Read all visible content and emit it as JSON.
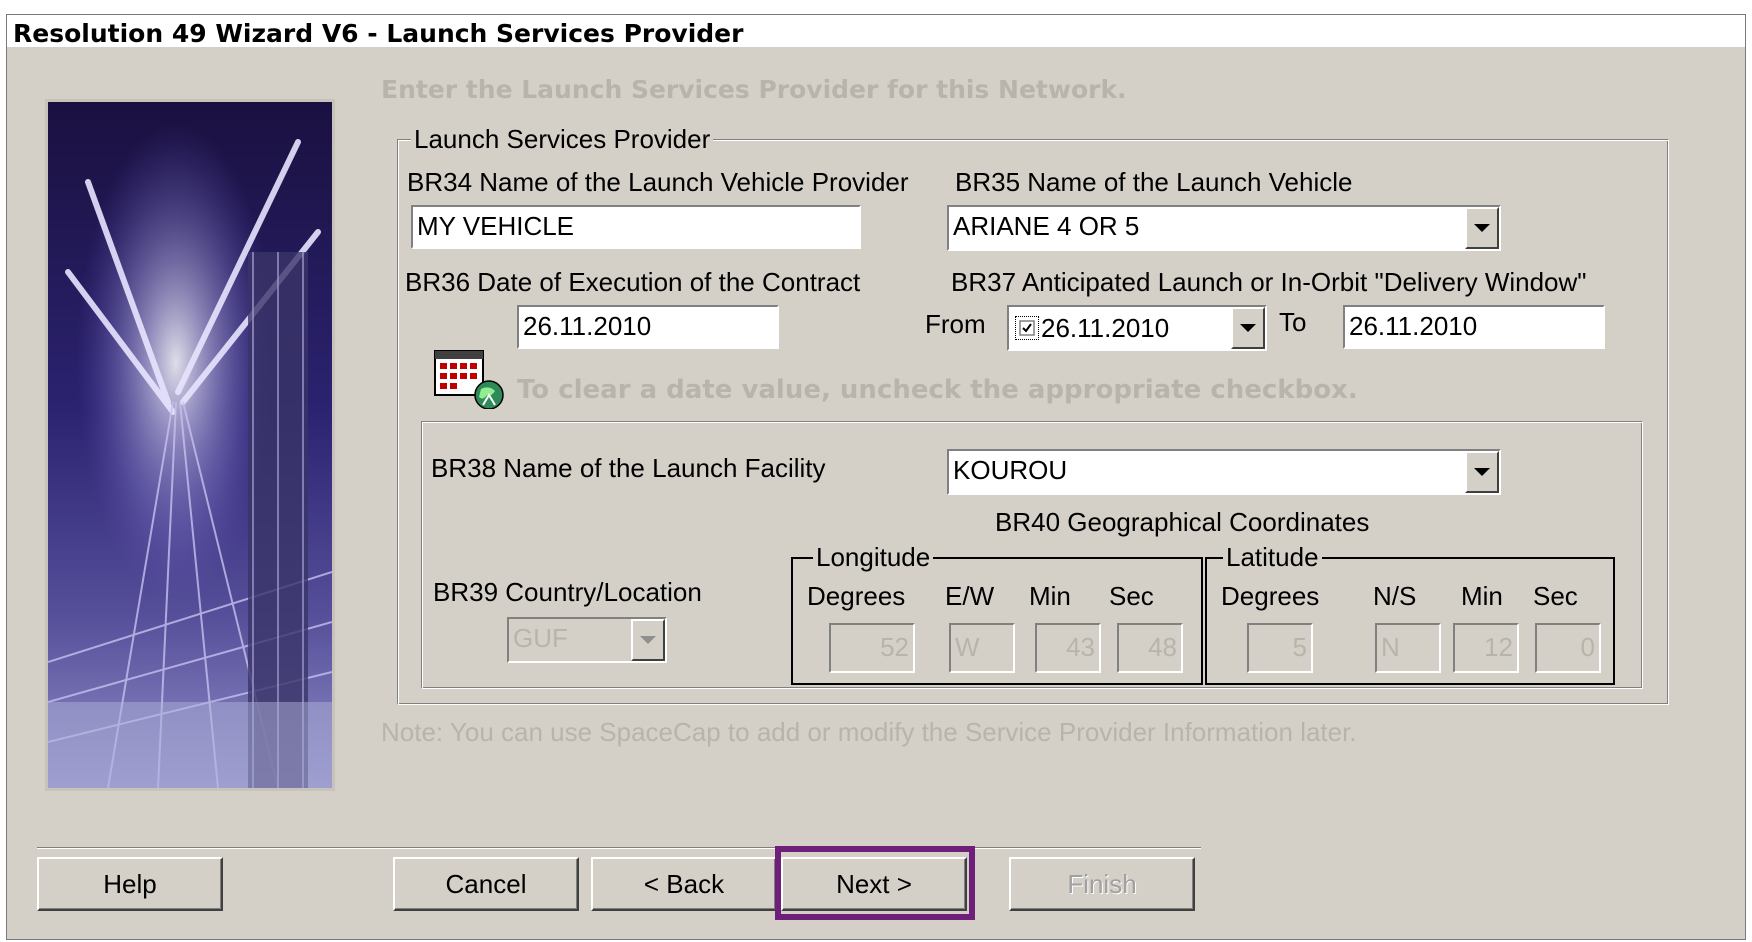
{
  "window": {
    "title": "Resolution 49 Wizard V6 - Launch Services Provider"
  },
  "instruction": "Enter the Launch Services Provider for this Network.",
  "group_launch": {
    "legend": "Launch Services Provider",
    "br34": {
      "label": "BR34  Name of the Launch Vehicle Provider",
      "value": "MY VEHICLE"
    },
    "br35": {
      "label": "BR35  Name of the Launch Vehicle",
      "value": "ARIANE 4 OR  5"
    },
    "br36": {
      "label": "BR36  Date of Execution of the Contract",
      "value": "26.11.2010"
    },
    "br37": {
      "label": "BR37  Anticipated Launch or In-Orbit \"Delivery Window\"",
      "from_label": "From",
      "from_value": "26.11.2010",
      "from_checked": true,
      "to_label": "To",
      "to_value": "26.11.2010"
    },
    "date_hint": "To clear a date value, uncheck the appropriate checkbox."
  },
  "facility": {
    "br38": {
      "label": "BR38  Name of the Launch Facility",
      "value": "KOUROU"
    },
    "br40_label": "BR40  Geographical Coordinates",
    "br39": {
      "label": "BR39 Country/Location",
      "value": "GUF"
    },
    "longitude": {
      "legend": "Longitude",
      "headers": [
        "Degrees",
        "E/W",
        "Min",
        "Sec"
      ],
      "values": [
        "52",
        "W",
        "43",
        "48"
      ]
    },
    "latitude": {
      "legend": "Latitude",
      "headers": [
        "Degrees",
        "N/S",
        "Min",
        "Sec"
      ],
      "values": [
        "5",
        "N",
        "12",
        "0"
      ]
    }
  },
  "note": "Note:  You can use SpaceCap to add or modify the Service Provider Information later.",
  "buttons": {
    "help": "Help",
    "cancel": "Cancel",
    "back": "< Back",
    "next": "Next >",
    "finish": "Finish"
  },
  "colors": {
    "highlight": "#6d1f79",
    "dialog_bg": "#d4d0c8",
    "disabled_text": "#b8b4ac"
  },
  "icons": [
    "calendar-icon",
    "globe-icon",
    "chevron-down-icon",
    "checkbox-icon"
  ]
}
